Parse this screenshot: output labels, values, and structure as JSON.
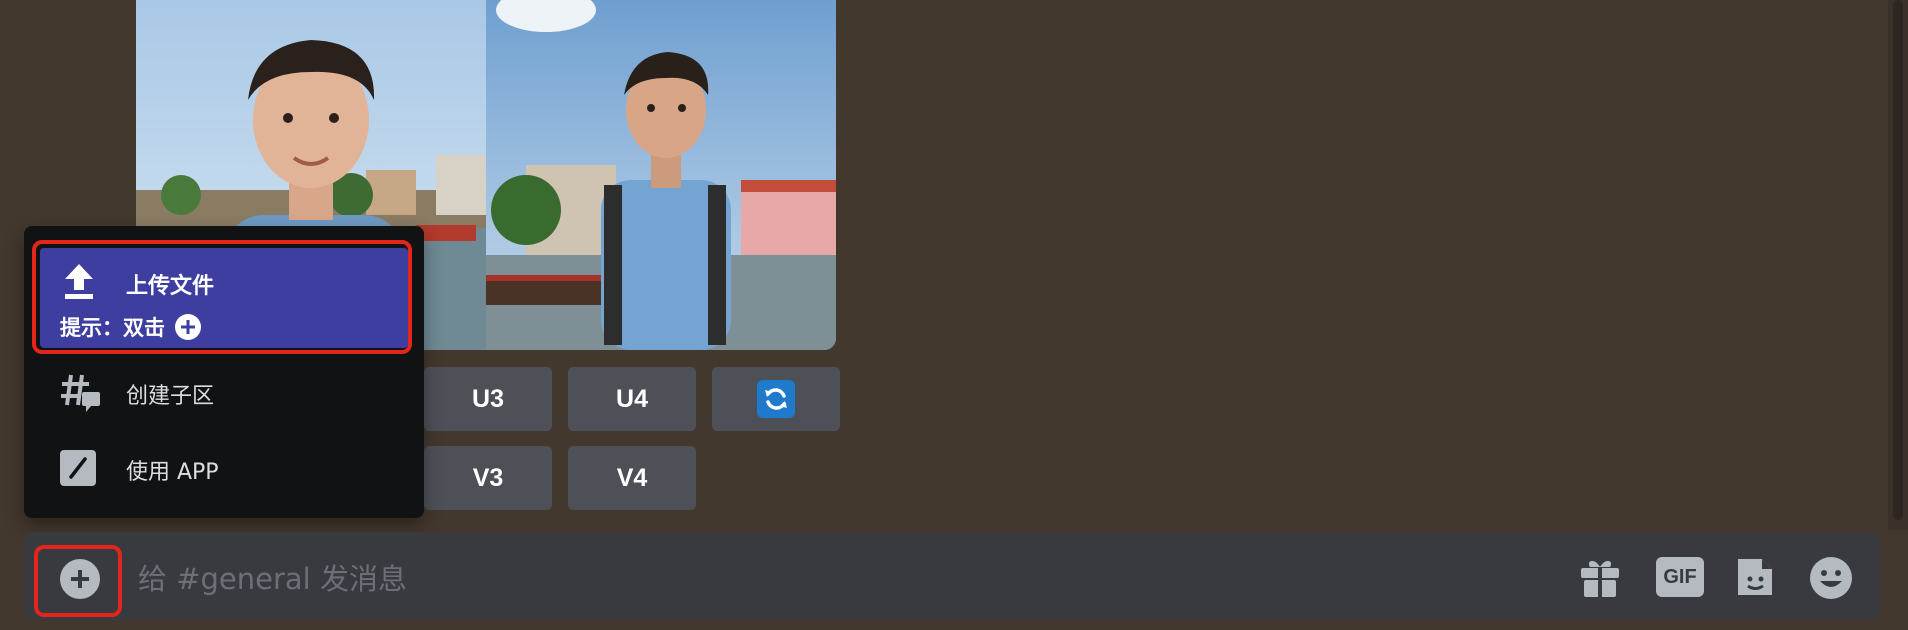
{
  "image_grid": {
    "tiles": [
      {
        "subject": "young man smiling in blue t-shirt by waterfront town"
      },
      {
        "subject": "young man with backpack on harbor with boats"
      }
    ]
  },
  "upscale_buttons": [
    "U3",
    "U4"
  ],
  "variation_buttons": [
    "V3",
    "V4"
  ],
  "refresh_button": {
    "icon": "refresh-icon"
  },
  "attach_menu": {
    "upload": {
      "label": "上传文件",
      "hint_text": "提示：双击",
      "icon": "upload-icon"
    },
    "items": [
      {
        "label": "创建子区",
        "icon": "thread-icon"
      },
      {
        "label": "使用 APP",
        "icon": "slash-command-icon"
      }
    ]
  },
  "composer": {
    "placeholder": "给 #general 发消息",
    "value": "",
    "attach_icon": "plus-circle-icon",
    "tools": [
      {
        "name": "gift-icon"
      },
      {
        "name": "gif-icon",
        "label": "GIF"
      },
      {
        "name": "sticker-icon"
      },
      {
        "name": "emoji-icon"
      }
    ]
  },
  "colors": {
    "chat_background": "#43382e",
    "menu_background": "#111214",
    "menu_highlight": "#3e3da0",
    "button_gray": "#4e5058",
    "focus_red": "#e3261b",
    "refresh_blue": "#1f7acc"
  }
}
